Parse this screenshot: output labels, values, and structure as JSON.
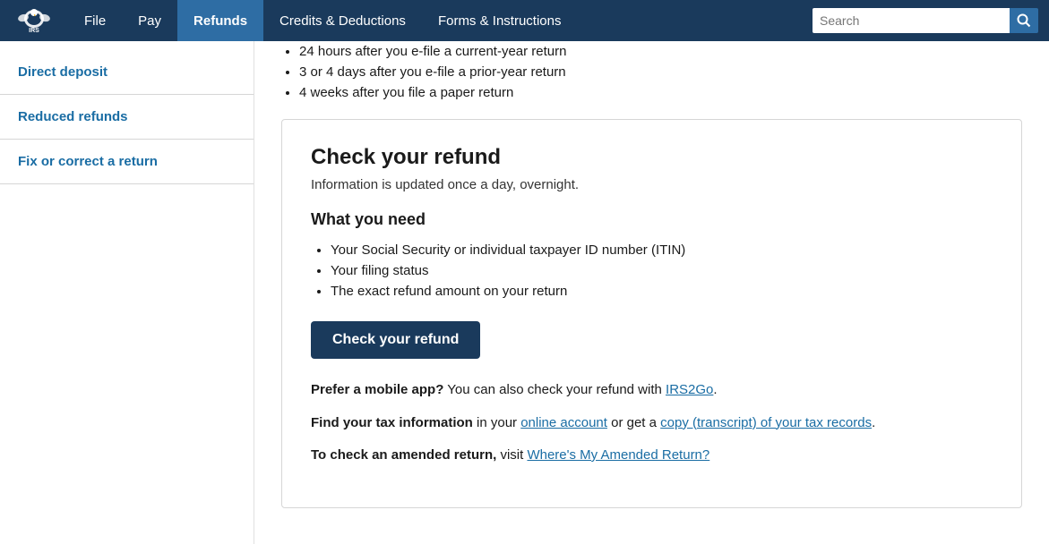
{
  "nav": {
    "logo_alt": "IRS",
    "links": [
      {
        "label": "File",
        "active": false
      },
      {
        "label": "Pay",
        "active": false
      },
      {
        "label": "Refunds",
        "active": true
      },
      {
        "label": "Credits & Deductions",
        "active": false
      },
      {
        "label": "Forms & Instructions",
        "active": false
      }
    ],
    "search_placeholder": "Search"
  },
  "sidebar": {
    "items": [
      {
        "label": "Direct deposit"
      },
      {
        "label": "Reduced refunds"
      },
      {
        "label": "Fix or correct a return"
      }
    ]
  },
  "main": {
    "pre_bullets": [
      "24 hours after you e-file a current-year return",
      "3 or 4 days after you e-file a prior-year return",
      "4 weeks after you file a paper return"
    ],
    "box": {
      "heading": "Check your refund",
      "subtitle": "Information is updated once a day, overnight.",
      "what_you_need_heading": "What you need",
      "what_you_need_items": [
        "Your Social Security or individual taxpayer ID number (ITIN)",
        "Your filing status",
        "The exact refund amount on your return"
      ],
      "button_label": "Check your refund",
      "mobile_app_prefix": "Prefer a mobile app?",
      "mobile_app_text": " You can also check your refund with ",
      "mobile_app_link": "IRS2Go",
      "mobile_app_suffix": ".",
      "find_tax_prefix": "Find your tax information",
      "find_tax_text": " in your ",
      "find_tax_link1": "online account",
      "find_tax_or": " or get a ",
      "find_tax_link2": "copy (transcript) of your tax records",
      "find_tax_suffix": ".",
      "amended_prefix": "To check an amended return,",
      "amended_text": " visit ",
      "amended_link": "Where's My Amended Return?"
    }
  }
}
